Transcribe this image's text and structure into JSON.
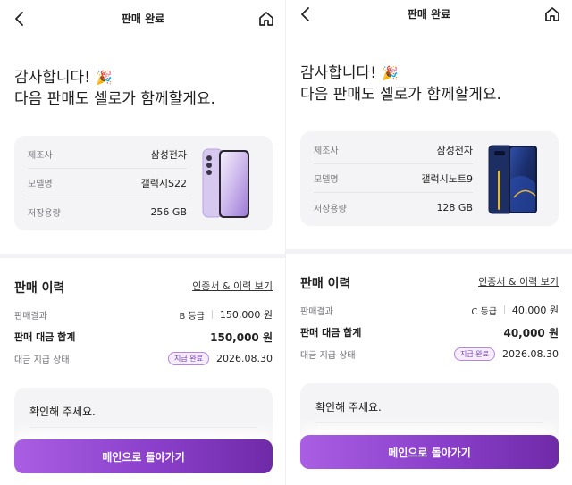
{
  "screens": [
    {
      "header": {
        "title": "판매 완료"
      },
      "greeting": {
        "line1": "감사합니다!",
        "party_emoji": "🎉",
        "line2": "다음 판매도 셀로가 함께할게요."
      },
      "product": {
        "specs": [
          {
            "label": "제조사",
            "value": "삼성전자"
          },
          {
            "label": "모델명",
            "value": "갤럭시S22"
          },
          {
            "label": "저장용량",
            "value": "256 GB"
          }
        ],
        "image_icon": "phone-lavender"
      },
      "history": {
        "title": "판매 이력",
        "cert_link": "인증서 & 이력 보기",
        "result_label": "판매결과",
        "grade": "B 등급",
        "result_price": "150,000 원",
        "total_label": "판매 대금 합계",
        "total_price": "150,000 원",
        "status_label": "대금 지급 상태",
        "status_badge": "지급 완료",
        "status_date": "2026.08.30"
      },
      "confirm": {
        "text": "확인해 주세요."
      },
      "main_button": "메인으로 돌아가기"
    },
    {
      "header": {
        "title": "판매 완료"
      },
      "greeting": {
        "line1": "감사합니다!",
        "party_emoji": "🎉",
        "line2": "다음 판매도 셀로가 함께할게요."
      },
      "product": {
        "specs": [
          {
            "label": "제조사",
            "value": "삼성전자"
          },
          {
            "label": "모델명",
            "value": "갤럭시노트9"
          },
          {
            "label": "저장용량",
            "value": "128 GB"
          }
        ],
        "image_icon": "phone-navy"
      },
      "history": {
        "title": "판매 이력",
        "cert_link": "인증서 & 이력 보기",
        "result_label": "판매결과",
        "grade": "C 등급",
        "result_price": "40,000 원",
        "total_label": "판매 대금 합계",
        "total_price": "40,000 원",
        "status_label": "대금 지급 상태",
        "status_badge": "지급 완료",
        "status_date": "2026.08.30"
      },
      "confirm": {
        "text": "확인해 주세요."
      },
      "main_button": "메인으로 돌아가기"
    }
  ],
  "colors": {
    "accent_start": "#a95ee3",
    "accent_end": "#6f2aa8",
    "badge_border": "#b784e3",
    "card_bg": "#f4f4f6"
  }
}
